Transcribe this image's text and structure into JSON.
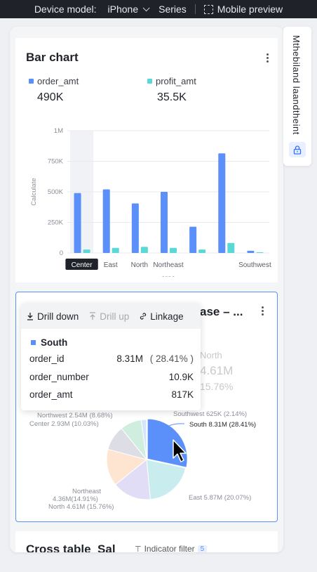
{
  "topbar": {
    "device_label": "Device model:",
    "device_value": "iPhone",
    "series_label": "Series",
    "preview_label": "Mobile preview"
  },
  "side_panel": {
    "text": "Mthebiland laandtheint"
  },
  "bar_card": {
    "title": "Bar chart",
    "legend": [
      {
        "name": "order_amt",
        "color": "#5b8ff9",
        "kpi": "490K"
      },
      {
        "name": "profit_amt",
        "color": "#5ad8d6",
        "kpi": "35.5K"
      }
    ]
  },
  "chart_data": [
    {
      "type": "bar",
      "categories": [
        "Center",
        "East",
        "North",
        "Northeast",
        "",
        "",
        "Southwest"
      ],
      "series": [
        {
          "name": "order_amt",
          "values": [
            490000,
            520000,
            405000,
            500000,
            215000,
            815000,
            18000
          ]
        },
        {
          "name": "profit_amt",
          "values": [
            28000,
            42000,
            50000,
            42000,
            28000,
            82000,
            6000
          ]
        }
      ],
      "title": "Bar chart",
      "xlabel": "area",
      "ylabel": "Calculate",
      "yticks": [
        "1M",
        "750K",
        "500K",
        "250K",
        "0"
      ],
      "ylim": [
        0,
        1000000
      ],
      "highlighted_category": "Center",
      "grid": true
    },
    {
      "type": "pie",
      "categories": [
        "South",
        "East",
        "North",
        "Northeast",
        "Center",
        "Northwest",
        "Southwest"
      ],
      "values": [
        28.41,
        20.07,
        15.76,
        14.91,
        10.03,
        8.68,
        2.14
      ],
      "colors": [
        "#5b8ff9",
        "#c9ecef",
        "#e2ddf7",
        "#fde5d2",
        "#dcdde5",
        "#cfeee0",
        "#d6e4fb"
      ]
    }
  ],
  "pie_card": {
    "title": "ase – ...",
    "bg_label_region": "North",
    "bg_value": "4.61M",
    "bg_percent": "15.76%",
    "labels": {
      "south": "South 8.31M (28.41%)",
      "east": "East 5.87M (20.07%)",
      "northeast_1": "Northeast",
      "northeast_2": "4.36M(14.91%)",
      "north": "North 4.61M (15.76%)",
      "northwest": "Northwest 2.54M (8.68%)",
      "center": "Center 2.93M (10.03%)",
      "southwest": "Southwest 625K (2.14%)"
    }
  },
  "tooltip": {
    "actions": [
      {
        "label": "Drill down",
        "disabled": false
      },
      {
        "label": "Drill up",
        "disabled": true
      },
      {
        "label": "Linkage",
        "disabled": false
      }
    ],
    "region": "South",
    "rows": [
      {
        "name": "order_id",
        "value": "8.31M",
        "pct": "( 28.41% )"
      },
      {
        "name": "order_number",
        "value": "10.9K"
      },
      {
        "name": "order_amt",
        "value": "817K"
      }
    ]
  },
  "table_card": {
    "title": "Cross table_Sal",
    "filter_label": "Indicator filter",
    "filter_count": "5"
  }
}
